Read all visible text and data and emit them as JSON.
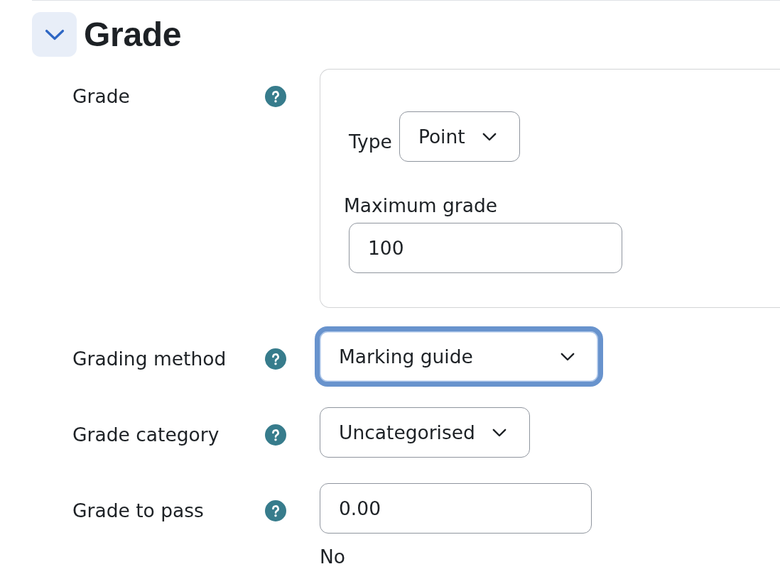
{
  "section": {
    "title": "Grade",
    "expanded": true
  },
  "fields": [
    {
      "kind": "group",
      "label": "Grade",
      "help": true,
      "items": [
        {
          "kind": "select",
          "label": "Type",
          "value": "Point",
          "focused": false
        },
        {
          "kind": "text",
          "label": "Maximum grade",
          "value": "100",
          "focused": false
        }
      ]
    },
    {
      "kind": "select",
      "label": "Grading method",
      "help": true,
      "value": "Marking guide",
      "focused": true
    },
    {
      "kind": "select",
      "label": "Grade category",
      "help": true,
      "value": "Uncategorised",
      "focused": false
    },
    {
      "kind": "text",
      "label": "Grade to pass",
      "help": true,
      "value": "0.00",
      "focused": false
    },
    {
      "kind": "static",
      "help": false,
      "value": "No"
    }
  ]
}
